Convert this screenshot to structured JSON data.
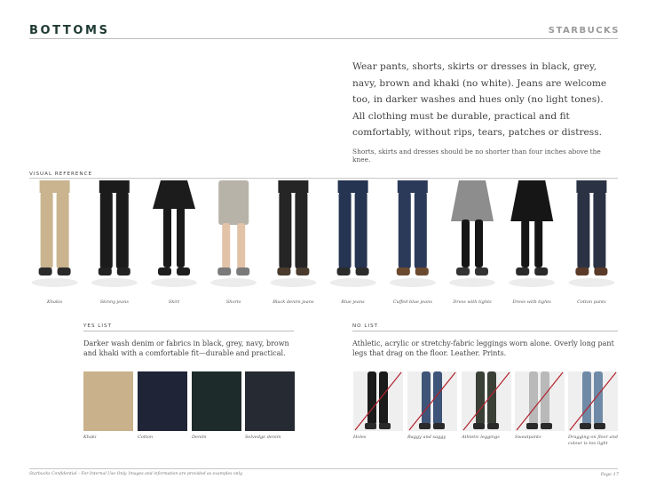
{
  "header": {
    "title": "BOTTOMS",
    "brand": "STARBUCKS"
  },
  "intro": {
    "main": "Wear pants, shorts, skirts or dresses in black, grey, navy, brown and khaki (no white). Jeans are welcome too, in darker washes and hues only (no light tones). All clothing must be durable, practical and fit comfortably, without rips, tears, patches or distress.",
    "note": "Shorts, skirts and dresses should be no shorter than four inches above the knee."
  },
  "visual_reference": {
    "label": "VISUAL REFERENCE",
    "figures": [
      {
        "caption": "Khakis",
        "legs": "#c9b48f",
        "shoes": "#2a2a2a",
        "type": "pants"
      },
      {
        "caption": "Skinny jeans",
        "legs": "#1b1b1b",
        "shoes": "#222222",
        "type": "pants"
      },
      {
        "caption": "Skirt",
        "legs": "#1a1a1a",
        "shoes": "#1e1e1e",
        "type": "skirt"
      },
      {
        "caption": "Shorts",
        "legs": "#b8b3a8",
        "shoes": "#7a7a7a",
        "type": "shorts"
      },
      {
        "caption": "Black denim jeans",
        "legs": "#252525",
        "shoes": "#4a3b2e",
        "type": "pants"
      },
      {
        "caption": "Blue jeans",
        "legs": "#253451",
        "shoes": "#2b2b2b",
        "type": "pants"
      },
      {
        "caption": "Cuffed blue jeans",
        "legs": "#2c3a5a",
        "shoes": "#6b4a30",
        "type": "pants"
      },
      {
        "caption": "Dress with tights",
        "legs": "#161616",
        "shoes": "#333333",
        "type": "dress-grey"
      },
      {
        "caption": "Dress with tights",
        "legs": "#151515",
        "shoes": "#2a2a2a",
        "type": "dress-black"
      },
      {
        "caption": "Cotton pants",
        "legs": "#2a3244",
        "shoes": "#5a3a28",
        "type": "pants"
      }
    ]
  },
  "yes_list": {
    "label": "YES LIST",
    "description": "Darker wash denim or fabrics in black, grey, navy, brown and khaki with a comfortable fit—durable and practical.",
    "swatches": [
      {
        "caption": "Khaki",
        "color": "#c9b28b"
      },
      {
        "caption": "Cotton",
        "color": "#1f2436"
      },
      {
        "caption": "Denim",
        "color": "#1e2b2b"
      },
      {
        "caption": "Selvedge denim",
        "color": "#262a33"
      }
    ]
  },
  "no_list": {
    "label": "NO LIST",
    "description": "Athletic, acrylic or stretchy-fabric leggings worn alone. Overly long pant legs that drag on the floor. Leather. Prints.",
    "items": [
      {
        "caption": "Holes",
        "legs": "#1b1b1b"
      },
      {
        "caption": "Baggy and saggy",
        "legs": "#3e5478"
      },
      {
        "caption": "Athletic leggings",
        "legs": "#3a4036"
      },
      {
        "caption": "Sweatpants",
        "legs": "#b9b9b9"
      },
      {
        "caption": "Dragging on floor and colour is too light",
        "legs": "#6f8aa6"
      }
    ]
  },
  "footer": {
    "left": "Starbucks Confidential – For Internal Use Only. Images and information are provided as examples only.",
    "right": "Page 17"
  },
  "colors": {
    "brand_green": "#1e3932",
    "strike_red": "#b3232f"
  }
}
